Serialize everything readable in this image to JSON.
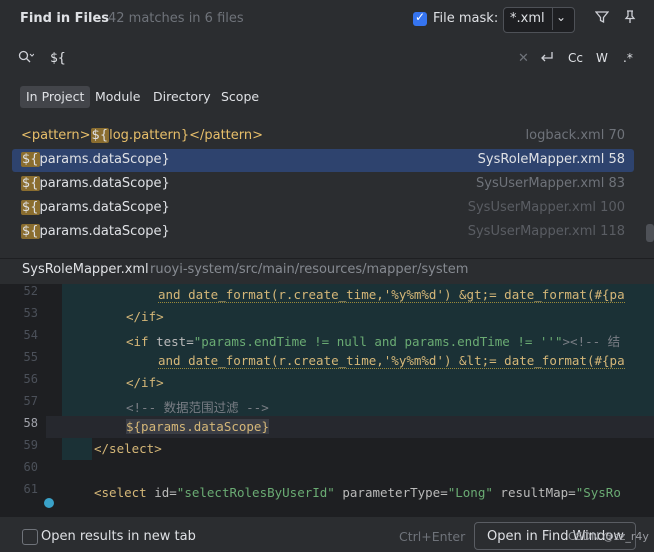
{
  "header": {
    "title": "Find in Files",
    "matches": "42 matches in 6 files",
    "file_mask_label": "File mask:",
    "file_mask_value": "*.xml"
  },
  "search": {
    "query": "${",
    "options": [
      "Cc",
      "W",
      ".*"
    ]
  },
  "scope_tabs": [
    "In Project",
    "Module",
    "Directory",
    "Scope"
  ],
  "results": [
    {
      "pre": "<pattern>",
      "match": "${",
      "post": "log.pattern}</pattern>",
      "file": "logback.xml",
      "line": "70"
    },
    {
      "pre": "",
      "match": "${",
      "post": "params.dataScope}",
      "file": "SysRoleMapper.xml",
      "line": "58"
    },
    {
      "pre": "",
      "match": "${",
      "post": "params.dataScope}",
      "file": "SysUserMapper.xml",
      "line": "83"
    },
    {
      "pre": "",
      "match": "${",
      "post": "params.dataScope}",
      "file": "SysUserMapper.xml",
      "line": "100"
    },
    {
      "pre": "",
      "match": "${",
      "post": "params.dataScope}",
      "file": "SysUserMapper.xml",
      "line": "118"
    }
  ],
  "preview": {
    "file": "SysRoleMapper.xml",
    "path": "ruoyi-system/src/main/resources/mapper/system"
  },
  "editor": {
    "line_numbers": [
      "52",
      "53",
      "54",
      "55",
      "56",
      "57",
      "58",
      "59",
      "60",
      "61"
    ],
    "line_52": "and date_format(r.create_time,'%y%m%d') &gt;= date_format(#{pa",
    "line_53": "</if>",
    "line_54_attr": "test=",
    "line_54_str": "\"params.endTime != null and params.endTime != ''\"",
    "line_54_cm": "><!-- 结",
    "line_55": "and date_format(r.create_time,'%y%m%d') &lt;= date_format(#{pa",
    "line_56": "</if>",
    "line_57": "<!-- 数据范围过滤 -->",
    "line_58": "${params.dataScope}",
    "line_59": "</select>",
    "line_61_tag": "<select",
    "line_61_id": "id=",
    "line_61_idval": "\"selectRolesByUserId\"",
    "line_61_pt": "parameterType=",
    "line_61_ptval": "\"Long\"",
    "line_61_rm": "resultMap=",
    "line_61_rmval": "\"SysRo"
  },
  "footer": {
    "open_new_tab": "Open results in new tab",
    "shortcut": "Ctrl+Enter",
    "open_button": "Open in Find Window",
    "watermark": "CSDN @zz_r4y"
  }
}
